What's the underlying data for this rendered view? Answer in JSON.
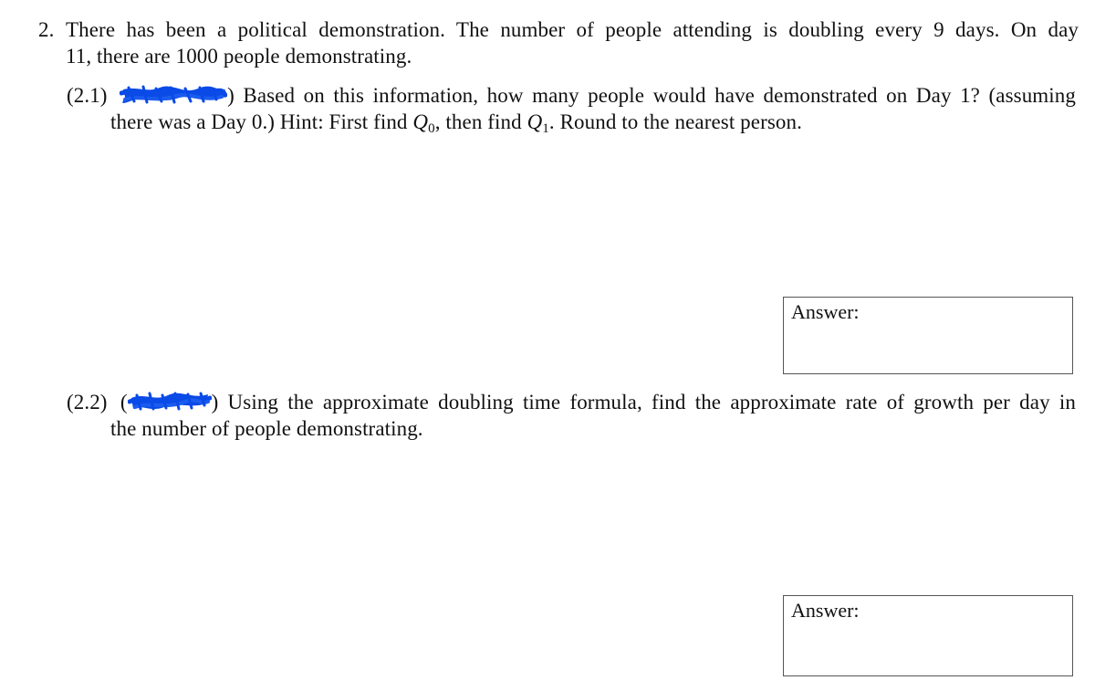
{
  "problem": {
    "number": "2.",
    "line1": "There has been a political demonstration. The number of people attending is doubling every 9 days. On day",
    "line2": "11, there are 1000 people demonstrating."
  },
  "parts": [
    {
      "label": "(2.1)",
      "redaction_color": "#0a4ae6",
      "line1_after": ") Based on this information, how many people would have demonstrated on Day 1? (assuming",
      "line2_a": "there was a Day 0.) Hint: First find ",
      "q0_var": "Q",
      "q0_sub": "0",
      "line2_b": ", then find ",
      "q1_var": "Q",
      "q1_sub": "1",
      "line2_c": ". Round to the nearest person.",
      "answer_label": "Answer:",
      "answer_value": ""
    },
    {
      "label": "(2.2)",
      "redaction_color": "#0a4ae6",
      "line1_before": "(",
      "line1_after": ") Using the approximate doubling time formula, find the approximate rate of growth per day in",
      "line2": "the number of people demonstrating.",
      "answer_label": "Answer:",
      "answer_value": ""
    }
  ],
  "colors": {
    "text": "#111111",
    "box_border": "#555555",
    "redaction": "#0a4ae6"
  }
}
